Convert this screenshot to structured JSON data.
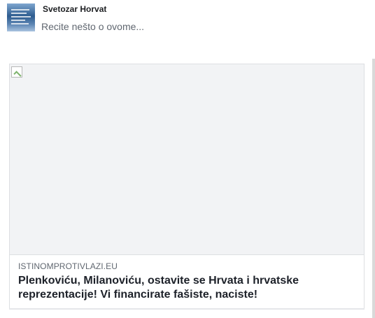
{
  "composer": {
    "user_name": "Svetozar Horvat",
    "placeholder": "Recite nešto o ovome..."
  },
  "link_preview": {
    "domain": "ISTINOMPROTIVLAZI.EU",
    "title": "Plenkoviću, Milanoviću, ostavite se Hrvata i hrvatske reprezentacije! Vi financirate fašiste, naciste!"
  }
}
